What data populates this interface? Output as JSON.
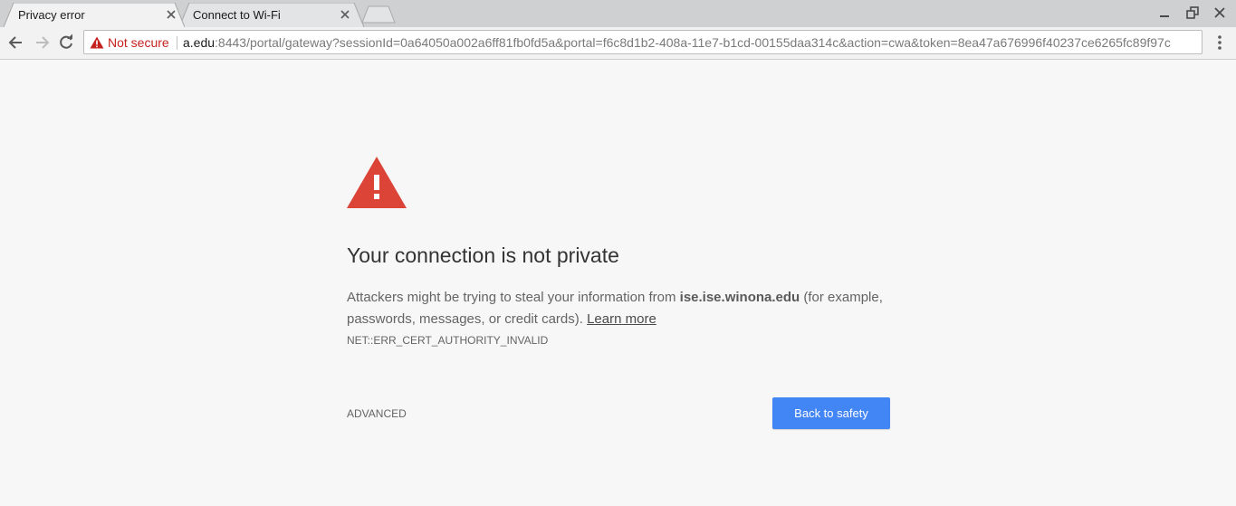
{
  "tabs": [
    {
      "title": "Privacy error",
      "active": true
    },
    {
      "title": "Connect to Wi-Fi",
      "active": false
    }
  ],
  "window_controls": [
    "minimize-icon",
    "restore-icon",
    "close-icon"
  ],
  "toolbar": {
    "back_icon": "back-arrow-icon",
    "forward_icon": "forward-arrow-icon",
    "reload_icon": "reload-icon",
    "security_status": "Not secure",
    "url_host": "a.edu",
    "url_rest": ":8443/portal/gateway?sessionId=0a64050a002a6ff81fb0fd5a&portal=f6c8d1b2-408a-11e7-b1cd-00155daa314c&action=cwa&token=8ea47a676996f40237ce6265fc89f97c",
    "menu_icon": "more-vert-icon"
  },
  "interstitial": {
    "heading": "Your connection is not private",
    "explanation_pre": "Attackers might be trying to steal your information from ",
    "host": "ise.ise.winona.edu",
    "explanation_post": " (for example, passwords, messages, or credit cards). ",
    "learn_more": "Learn more",
    "error_code": "NET::ERR_CERT_AUTHORITY_INVALID",
    "advanced": "ADVANCED",
    "back_to_safety": "Back to safety"
  },
  "colors": {
    "warning_red": "#db4437",
    "not_secure_red": "#c5221f",
    "primary_button": "#4285f4",
    "page_background": "#f7f7f7"
  }
}
